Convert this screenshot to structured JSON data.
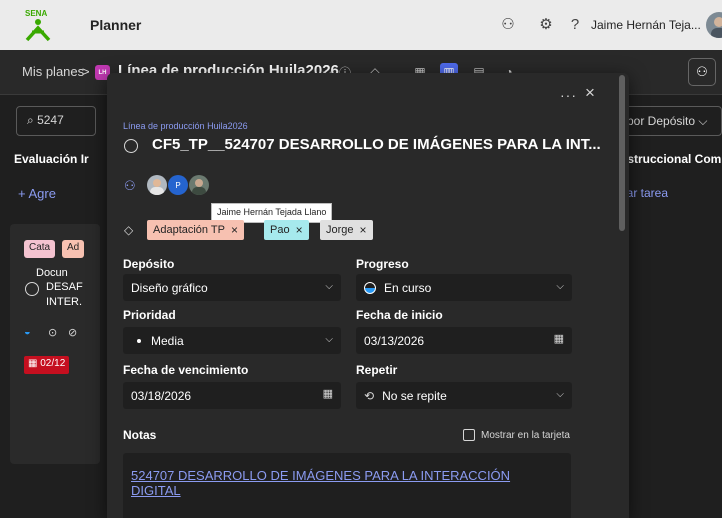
{
  "app": {
    "name": "Planner",
    "user_name": "Jaime Hernán Teja...",
    "logo_text": "SENA"
  },
  "planbar": {
    "breadcrumb_root": "Mis planes",
    "separator": ">",
    "plan_badge": "LH",
    "plan_title": "Línea de producción Huila2026"
  },
  "board": {
    "search_value": "5247",
    "bucket_left": "Evaluación Ir",
    "add_task_left": "+ Agre",
    "card_tags": [
      "Cata",
      "Ad"
    ],
    "card_lines": [
      "Docun",
      "DESAF",
      "INTER."
    ],
    "card_date": "02/12",
    "filter_label": "por Depósito",
    "bucket_right": "nstruccional Compe",
    "add_task_right": "gar tarea"
  },
  "task": {
    "plan_name": "Línea de producción Huila2026",
    "title": "CF5_TP__524707 DESARROLLO DE IMÁGENES PARA LA INT...",
    "tooltip": "Jaime Hernán Tejada Llano",
    "tags": [
      {
        "label": "Adaptación TP",
        "color": "#f7c1b1"
      },
      {
        "label": "Pao",
        "color": "#a6e9ed"
      },
      {
        "label": "Jorge",
        "color": "#e0e0e0"
      }
    ],
    "fields": {
      "bucket_label": "Depósito",
      "bucket_value": "Diseño gráfico",
      "progress_label": "Progreso",
      "progress_value": "En curso",
      "priority_label": "Prioridad",
      "priority_value": "Media",
      "start_label": "Fecha de inicio",
      "start_value": "03/13/2026",
      "due_label": "Fecha de vencimiento",
      "due_value": "03/18/2026",
      "repeat_label": "Repetir",
      "repeat_value": "No se repite"
    },
    "notes_label": "Notas",
    "show_on_card": "Mostrar en la tarjeta",
    "notes_link": "524707 DESARROLLO DE IMÁGENES PARA LA INTERACCIÓN DIGITAL"
  },
  "icons": {
    "close": "×",
    "more": "···",
    "chevron": "⌵",
    "help": "?",
    "settings": "⚙",
    "assign": "⚇"
  },
  "colors": {
    "accent": "#8b9bf1",
    "active_view": "#4f6bed",
    "plan_badge": "#c239b3",
    "progress_blue": "#2899f5",
    "date_red": "#c50f1f"
  }
}
